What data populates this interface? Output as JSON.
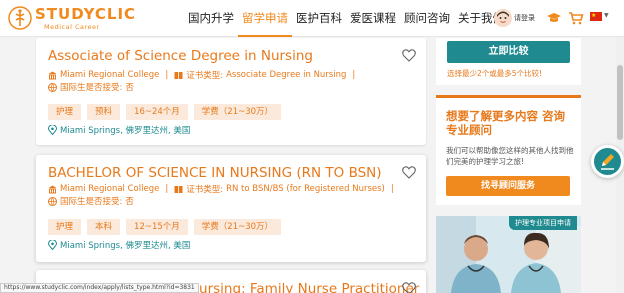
{
  "brand": {
    "name": "STUDYCLIC",
    "sub": "Medical Career",
    "accent": "#f08a1e",
    "teal": "#1f8a8f"
  },
  "nav": {
    "items": [
      {
        "label": "国内升学",
        "active": false
      },
      {
        "label": "留学申请",
        "active": true
      },
      {
        "label": "医护百科",
        "active": false
      },
      {
        "label": "爱医课程",
        "active": false
      },
      {
        "label": "顾问咨询",
        "active": false
      },
      {
        "label": "关于我们",
        "active": false
      }
    ],
    "login_label": "请登录",
    "icons": [
      "user-avatar",
      "cap-icon",
      "cart-icon",
      "china-flag-icon"
    ]
  },
  "programs": [
    {
      "title": "Associate of Science Degree in Nursing",
      "school": "Miami Regional College",
      "cert_label": "证书类型:",
      "cert_value": "Associate Degree in Nursing",
      "intl_label": "国际生是否接受:",
      "intl_value": "否",
      "tags": [
        "护理",
        "预科",
        "16~24个月",
        "学费（21~30万）"
      ],
      "location": "Miami Springs, 佛罗里达州, 美国"
    },
    {
      "title": "BACHELOR OF SCIENCE IN NURSING (RN TO BSN)",
      "school": "Miami Regional College",
      "cert_label": "证书类型:",
      "cert_value": "RN to BSN/BS (for Registered Nurses)",
      "intl_label": "国际生是否接受:",
      "intl_value": "否",
      "tags": [
        "护理",
        "本科",
        "12~15个月",
        "学费（21~30万）"
      ],
      "location": "Miami Springs, 佛罗里达州, 美国"
    },
    {
      "title": "Master of Science in Nursing: Family Nurse Practitioner"
    }
  ],
  "sidebar": {
    "compare_button": "立即比较",
    "compare_hint": "选择最少2个或最多5个比较!",
    "consult_title": "想要了解更多内容 咨询专业顾问",
    "consult_text": "我们可以帮助像您这样的其他人找到他们完美的护理学习之旅!",
    "consult_button": "找寻顾问服务",
    "promo_badge": "护理专业项目申请"
  },
  "status_url": "https://www.studyclic.com/index/apply/lists_type.html?id=3831"
}
